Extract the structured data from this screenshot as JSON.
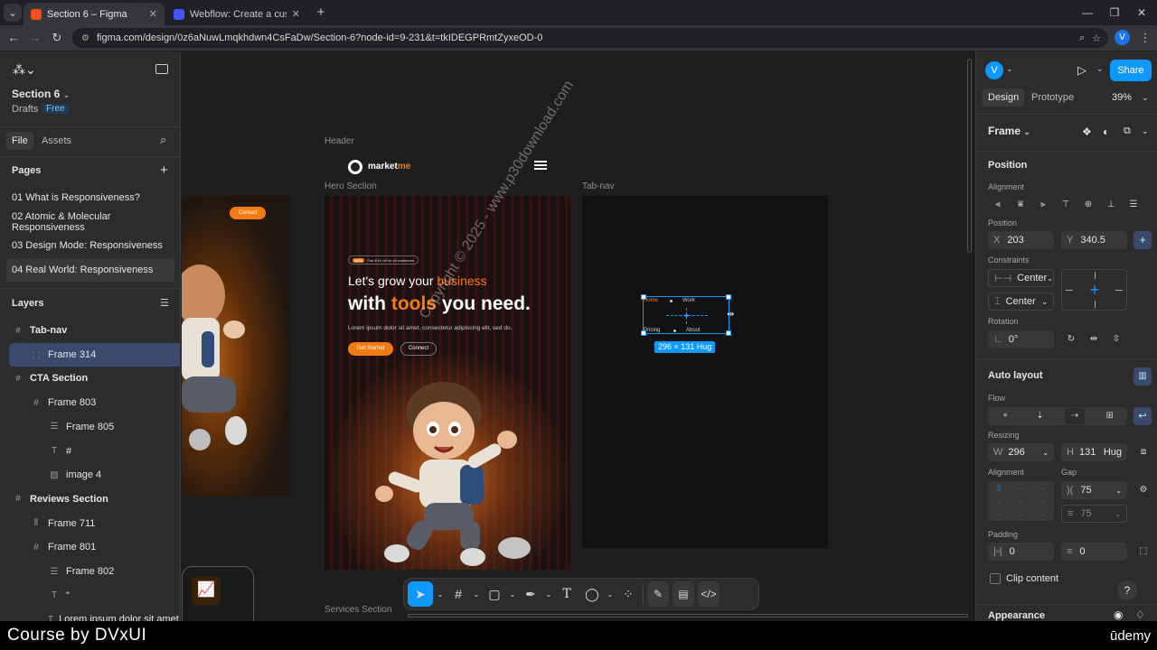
{
  "browser": {
    "tabs": [
      {
        "title": "Section 6 – Figma",
        "active": true
      },
      {
        "title": "Webflow: Create a custom web",
        "active": false
      }
    ],
    "new_tab_icon": "plus-icon",
    "url": "figma.com/design/0z6aNuwLmqkhdwn4CsFaDw/Section-6?node-id=9-231&t=tkIDEGPRmtZyxeOD-0",
    "profile_initial": "V"
  },
  "file": {
    "name": "Section 6",
    "location": "Drafts",
    "plan_badge": "Free"
  },
  "left_tabs": {
    "file": "File",
    "assets": "Assets"
  },
  "pages": {
    "heading": "Pages",
    "items": [
      "01 What is Responsiveness?",
      "02 Atomic & Molecular Responsiveness",
      "03 Design Mode: Responsiveness",
      "04 Real World: Responsiveness"
    ]
  },
  "layers": {
    "heading": "Layers",
    "items": [
      {
        "label": "Tab-nav",
        "icon": "frame-icon",
        "level": 0
      },
      {
        "label": "Frame 314",
        "icon": "autolayout-icon",
        "level": 1,
        "selected": true
      },
      {
        "label": "CTA Section",
        "icon": "frame-icon",
        "level": 0
      },
      {
        "label": "Frame 803",
        "icon": "frame-icon",
        "level": 1
      },
      {
        "label": "Frame 805",
        "icon": "stack-icon",
        "level": 2
      },
      {
        "label": "#",
        "icon": "text-icon",
        "level": 2
      },
      {
        "label": "image 4",
        "icon": "image-icon",
        "level": 2
      },
      {
        "label": "Reviews Section",
        "icon": "frame-icon",
        "level": 0
      },
      {
        "label": "Frame 711",
        "icon": "columns-icon",
        "level": 1
      },
      {
        "label": "Frame 801",
        "icon": "frame-icon",
        "level": 1
      },
      {
        "label": "Frame 802",
        "icon": "stack-icon",
        "level": 2
      },
      {
        "label": "\"",
        "icon": "text-icon",
        "level": 2
      },
      {
        "label": "Lorem ipsum dolor sit amet, c",
        "icon": "text-icon",
        "level": 2
      }
    ]
  },
  "canvas": {
    "labels": {
      "header": "Header",
      "hero": "Hero Section",
      "tabnav": "Tab-nav",
      "services": "Services Section"
    },
    "left_frame_button": "Contact",
    "header_logo_text": "market",
    "header_logo_accent": "me",
    "hero": {
      "badge_new": "NEW",
      "badge_text": "Flat 40% off for all customers",
      "line1_a": "Let's grow your ",
      "line1_b": "business",
      "line2_a": "with ",
      "line2_b": "tools",
      "line2_c": " you need.",
      "body": "Lorem ipsum dolor sit amet, consectetur adipiscing elit, sed do.",
      "btn_primary": "Get Started",
      "btn_secondary": "Connect"
    },
    "tabnav_items": [
      "Home",
      "Work",
      "Pricing",
      "About"
    ],
    "selection_size": "296 × 131 Hug",
    "watermark": "Copyright © 2025 - www.p30download.com"
  },
  "right_panel": {
    "avatar_initial": "V",
    "share": "Share",
    "tabs": {
      "design": "Design",
      "prototype": "Prototype"
    },
    "zoom": "39%",
    "frame_label": "Frame",
    "position": {
      "heading": "Position",
      "alignment_label": "Alignment",
      "position_label": "Position",
      "x_label": "X",
      "x": "203",
      "y_label": "Y",
      "y": "340.5",
      "constraints_label": "Constraints",
      "constraint_h": "Center",
      "constraint_v": "Center",
      "rotation_label": "Rotation",
      "rotation": "0°"
    },
    "auto_layout": {
      "heading": "Auto layout",
      "flow_label": "Flow",
      "resizing_label": "Resizing",
      "w_label": "W",
      "w": "296",
      "h_label": "H",
      "h": "131",
      "h_mode": "Hug",
      "alignment_label": "Alignment",
      "gap_label": "Gap",
      "gap": "75",
      "gap_secondary": "75",
      "padding_label": "Padding",
      "padding_h": "0",
      "padding_v": "0",
      "clip_content": "Clip content"
    },
    "appearance": "Appearance",
    "help": "?"
  },
  "footer": {
    "left": "Course by DVxUI",
    "right": "ūdemy"
  },
  "colors": {
    "accent": "#0d99ff",
    "orange": "#f47a12",
    "selected_row": "#3b4a6b"
  }
}
